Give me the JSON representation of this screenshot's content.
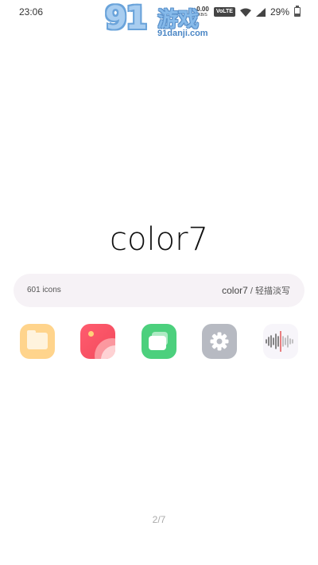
{
  "status_bar": {
    "time": "23:06",
    "net_speed_value": "0.00",
    "net_speed_unit": "KB/S",
    "volte": "VoLTE",
    "battery": "29%"
  },
  "watermark": {
    "logo": "91",
    "text": "游戏",
    "url": "91danji.com"
  },
  "brand": {
    "logo_text": "color7"
  },
  "info": {
    "icon_count": "601 icons",
    "pack_name": "color7",
    "separator": "/",
    "pack_subtitle": "轻描淡写"
  },
  "icons": [
    {
      "name": "files-app-icon",
      "color": "#ffd48c"
    },
    {
      "name": "photos-app-icon",
      "color": "#f24a5c"
    },
    {
      "name": "messages-app-icon",
      "color": "#4cd07d"
    },
    {
      "name": "settings-app-icon",
      "color": "#b7bac2"
    },
    {
      "name": "recorder-app-icon",
      "color": "#f7f5fa"
    }
  ],
  "pagination": {
    "label": "2/7"
  }
}
